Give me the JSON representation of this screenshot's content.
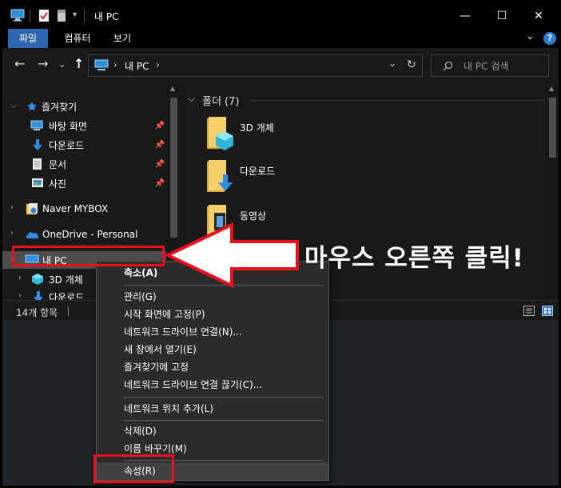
{
  "window": {
    "title": "내 PC",
    "controls": {
      "minimize": "—",
      "maximize": "☐",
      "close": "✕"
    }
  },
  "ribbon": {
    "tabs": [
      {
        "label": "파일",
        "active": true
      },
      {
        "label": "컴퓨터",
        "active": false
      },
      {
        "label": "보기",
        "active": false
      }
    ],
    "collapse": "⌄",
    "help": "?"
  },
  "address": {
    "back": "←",
    "forward": "→",
    "history": "⌄",
    "up": "↑",
    "path_sep": "›",
    "path": "내 PC",
    "dropdown": "⌄",
    "refresh": "↻",
    "search_placeholder": "내 PC 검색"
  },
  "nav": {
    "quick_access": "즐겨찾기",
    "pinned": [
      {
        "label": "바탕 화면",
        "icon": "desktop-icon"
      },
      {
        "label": "다운로드",
        "icon": "download-icon"
      },
      {
        "label": "문서",
        "icon": "document-icon"
      },
      {
        "label": "사진",
        "icon": "pictures-icon"
      }
    ],
    "mybox": "Naver MYBOX",
    "onedrive": "OneDrive - Personal",
    "this_pc": "내 PC",
    "sub": [
      {
        "label": "3D 개체"
      },
      {
        "label": "다운로드"
      }
    ]
  },
  "content": {
    "group_header": "폴더 (7)",
    "folders": [
      {
        "label": "3D 개체"
      },
      {
        "label": "다운로드"
      },
      {
        "label": "동영상"
      }
    ]
  },
  "status": {
    "items": "14개 항목"
  },
  "context_menu": {
    "items": [
      {
        "label": "축소(A)",
        "bold": true
      },
      {
        "label": "관리(G)"
      },
      {
        "label": "시작 화면에 고정(P)"
      },
      {
        "label": "네트워크 드라이브 연결(N)..."
      },
      {
        "label": "새 창에서 열기(E)"
      },
      {
        "label": "즐겨찾기에 고정"
      },
      {
        "label": "네트워크 드라이브 연결 끊기(C)..."
      },
      {
        "label": "네트워크 위치 추가(L)"
      },
      {
        "label": "삭제(D)"
      },
      {
        "label": "이름 바꾸기(M)"
      },
      {
        "label": "속성(R)"
      }
    ]
  },
  "annotation": {
    "callout": "마우스 오른쪽 클릭!",
    "color": "#e8101c"
  }
}
